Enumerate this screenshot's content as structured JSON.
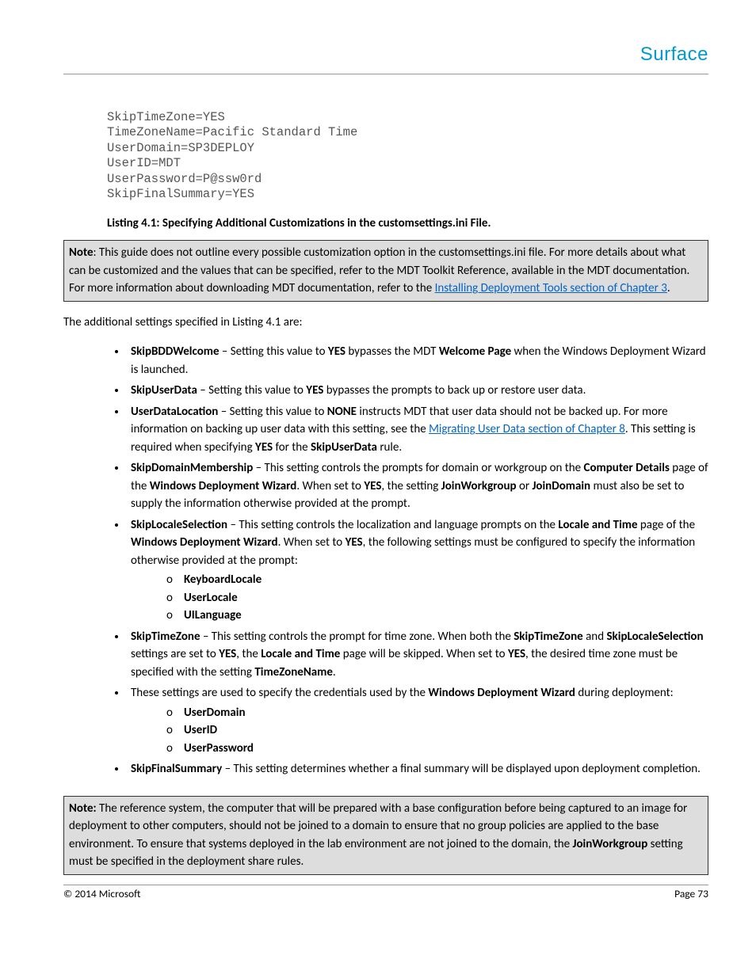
{
  "header": {
    "brand": "Surface"
  },
  "code": "SkipTimeZone=YES\nTimeZoneName=Pacific Standard Time\nUserDomain=SP3DEPLOY\nUserID=MDT\nUserPassword=P@ssw0rd\nSkipFinalSummary=YES",
  "listing_caption": "Listing 4.1: Specifying Additional Customizations in the customsettings.ini File.",
  "note1": {
    "label": "Note",
    "text": ": This guide does not outline every possible customization option in the customsettings.ini file. For more details about what can be customized and the values that can be specified, refer to the MDT Toolkit Reference, available in the MDT documentation. For more information about downloading MDT documentation, refer to the ",
    "link_text": "Installing Deployment Tools section of Chapter 3",
    "after": "."
  },
  "intro": "The additional settings specified in Listing 4.1 are:",
  "bullets": {
    "b1_name": "SkipBDDWelcome",
    "b1_a": " – Setting this value to ",
    "b1_yes": "YES",
    "b1_b": " bypasses the MDT ",
    "b1_wp": "Welcome Page",
    "b1_c": " when the Windows Deployment Wizard is launched.",
    "b2_name": "SkipUserData",
    "b2_a": " – Setting this value to ",
    "b2_yes": "YES",
    "b2_b": " bypasses the prompts to back up or restore user data.",
    "b3_name": "UserDataLocation",
    "b3_a": " – Setting this value to ",
    "b3_none": "NONE",
    "b3_b": " instructs MDT that user data should not be backed up. For more information on backing up user data with this setting, see the ",
    "b3_link": "Migrating User Data section of Chapter 8",
    "b3_c": ". This setting is required when specifying ",
    "b3_yes": "YES",
    "b3_d": " for the ",
    "b3_rule": "SkipUserData",
    "b3_e": " rule.",
    "b4_name": "SkipDomainMembership",
    "b4_a": " – This setting controls the prompts for domain or workgroup on the ",
    "b4_cd": "Computer Details",
    "b4_b": " page of the ",
    "b4_wdw": "Windows Deployment Wizard",
    "b4_c": ". When set to ",
    "b4_yes": "YES",
    "b4_d": ", the setting ",
    "b4_jw": "JoinWorkgroup",
    "b4_e": " or ",
    "b4_jd": "JoinDomain",
    "b4_f": " must also be set to supply the information otherwise provided at the prompt.",
    "b5_name": "SkipLocaleSelection",
    "b5_a": " – This setting controls the localization and language prompts on the ",
    "b5_lt": "Locale and Time",
    "b5_b": " page of the ",
    "b5_wdw": "Windows Deployment Wizard",
    "b5_c": ". When set to ",
    "b5_yes": "YES",
    "b5_d": ", the following settings must be configured to specify the information otherwise provided at the prompt:",
    "b5_s1": "KeyboardLocale",
    "b5_s2": "UserLocale",
    "b5_s3": "UILanguage",
    "b6_name": "SkipTimeZone",
    "b6_a": " – This setting controls the prompt for time zone. When both the ",
    "b6_stz": "SkipTimeZone",
    "b6_b": " and ",
    "b6_sls": "SkipLocaleSelection",
    "b6_c": " settings are set to ",
    "b6_yes": "YES",
    "b6_d": ", the ",
    "b6_lt": "Locale and Time",
    "b6_e": " page will be skipped. When set to ",
    "b6_yes2": "YES",
    "b6_f": ", the desired time zone must be specified with the setting ",
    "b6_tzn": "TimeZoneName",
    "b6_g": ".",
    "b7_a": "These settings are used to specify the credentials used by the ",
    "b7_wdw": "Windows Deployment Wizard",
    "b7_b": " during deployment:",
    "b7_s1": "UserDomain",
    "b7_s2": "UserID",
    "b7_s3": "UserPassword",
    "b8_name": "SkipFinalSummary",
    "b8_a": " – This setting determines whether a final summary will be displayed upon deployment completion."
  },
  "note2": {
    "label": "Note:",
    "text_a": " The reference system, the computer that will be prepared with a base configuration before being captured to an image for deployment to other computers, should not be joined to a domain to ensure that no group policies are applied to the base environment. To ensure that systems deployed in the lab environment are not joined to the domain, the ",
    "jw": "JoinWorkgroup",
    "text_b": " setting must be specified in the deployment share rules."
  },
  "footer": {
    "copyright": "© 2014 Microsoft",
    "page": "Page 73"
  }
}
